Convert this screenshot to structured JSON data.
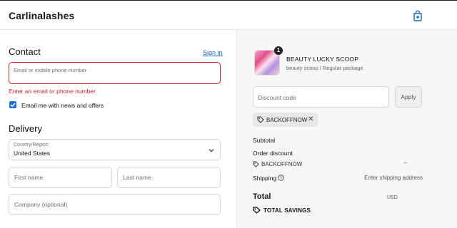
{
  "header": {
    "brand": "Carlinalashes",
    "cart_icon": "shopping-bag-icon"
  },
  "contact": {
    "title": "Contact",
    "sign_in": "Sign in",
    "email_placeholder": "Email or mobile phone number",
    "error": "Enter an email or phone number",
    "newsletter_label": "Email me with news and offers",
    "newsletter_checked": true
  },
  "delivery": {
    "title": "Delivery",
    "country_label": "Country/Region",
    "country_value": "United States",
    "first_name_placeholder": "First name",
    "last_name_placeholder": "Last name",
    "company_placeholder": "Company (optional)"
  },
  "summary": {
    "quantity": "1",
    "product_name": "BEAUTY LUCKY SCOOP",
    "product_variant": "beauty scoop / Regular package",
    "discount_placeholder": "Discount code",
    "apply_label": "Apply",
    "applied_code": "BACKOFFNOW",
    "subtotal_label": "Subtotal",
    "order_discount_label": "Order discount",
    "discount_code_label": "BACKOFFNOW",
    "discount_value": "–",
    "shipping_label": "Shipping",
    "shipping_value": "Enter shipping address",
    "total_label": "Total",
    "currency": "USD",
    "savings_label": "TOTAL SAVINGS"
  },
  "colors": {
    "accent": "#1a73d8",
    "error": "#d0232b",
    "link": "#1668c9"
  }
}
